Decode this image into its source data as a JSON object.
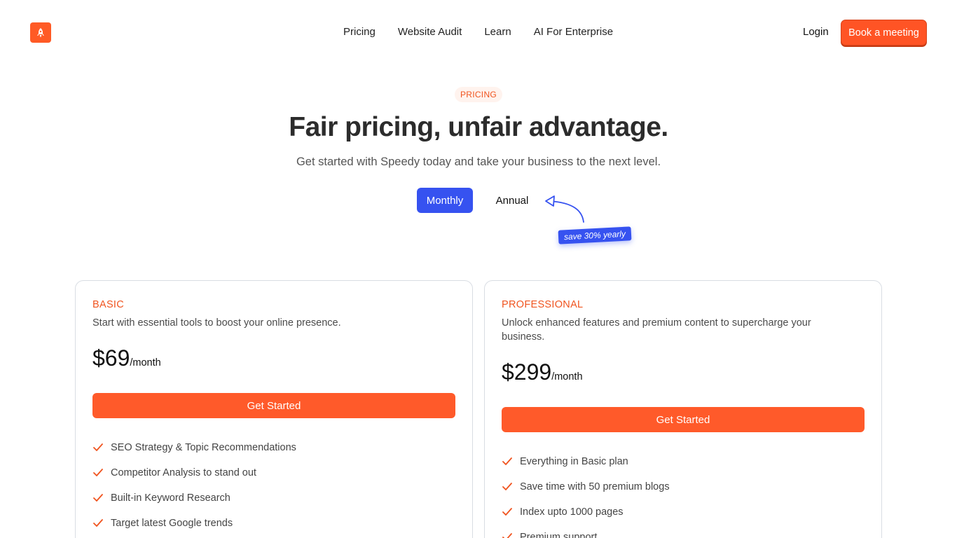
{
  "nav": {
    "logo_icon": "rocket-icon",
    "links": [
      "Pricing",
      "Website Audit",
      "Learn",
      "AI For Enterprise"
    ],
    "login": "Login",
    "cta": "Book a meeting"
  },
  "hero": {
    "badge": "PRICING",
    "title": "Fair pricing, unfair advantage.",
    "subtitle": "Get started with Speedy today and take your business to the next level."
  },
  "billing_toggle": {
    "monthly": "Monthly",
    "annual": "Annual",
    "selected": "Monthly",
    "save_note": "save 30% yearly"
  },
  "plans": [
    {
      "name": "BASIC",
      "description": "Start with essential tools to boost your online presence.",
      "price": "$69",
      "period": "/month",
      "cta": "Get Started",
      "features": [
        "SEO Strategy & Topic Recommendations",
        "Competitor Analysis to stand out",
        "Built-in Keyword Research",
        "Target latest Google trends"
      ]
    },
    {
      "name": "PROFESSIONAL",
      "description": "Unlock enhanced features and premium content to supercharge your business.",
      "price": "$299",
      "period": "/month",
      "cta": "Get Started",
      "features": [
        "Everything in Basic plan",
        "Save time with 50 premium blogs",
        "Index upto 1000 pages",
        "Premium support"
      ]
    }
  ],
  "colors": {
    "brand": "#ff5a25",
    "accent": "#3652f0"
  }
}
